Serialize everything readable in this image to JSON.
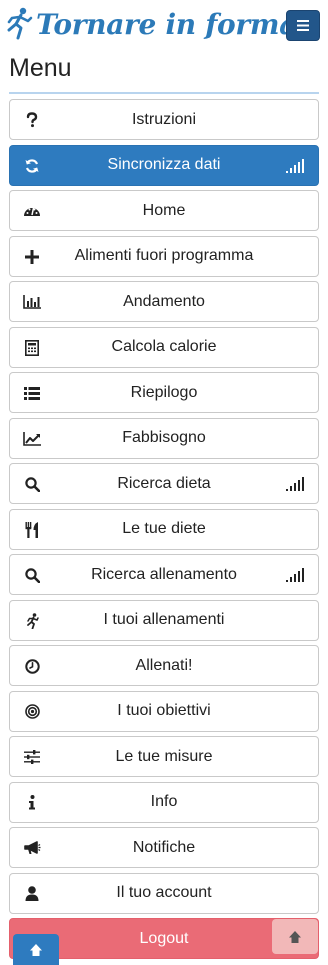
{
  "header": {
    "title": "Tornare in forma!"
  },
  "menu": {
    "title": "Menu",
    "items": [
      {
        "label": "Istruzioni",
        "icon": "question-icon",
        "signal": false
      },
      {
        "label": "Sincronizza dati",
        "icon": "sync-icon",
        "signal": true,
        "active": true
      },
      {
        "label": "Home",
        "icon": "dashboard-icon",
        "signal": false
      },
      {
        "label": "Alimenti fuori programma",
        "icon": "plus-icon",
        "signal": false
      },
      {
        "label": "Andamento",
        "icon": "bar-chart-icon",
        "signal": false
      },
      {
        "label": "Calcola calorie",
        "icon": "calculator-icon",
        "signal": false
      },
      {
        "label": "Riepilogo",
        "icon": "list-icon",
        "signal": false
      },
      {
        "label": "Fabbisogno",
        "icon": "line-chart-icon",
        "signal": false
      },
      {
        "label": "Ricerca dieta",
        "icon": "search-icon",
        "signal": true
      },
      {
        "label": "Le tue diete",
        "icon": "utensils-icon",
        "signal": false
      },
      {
        "label": "Ricerca allenamento",
        "icon": "search-icon",
        "signal": true
      },
      {
        "label": "I tuoi allenamenti",
        "icon": "running-icon",
        "signal": false
      },
      {
        "label": "Allenati!",
        "icon": "clock-icon",
        "signal": false
      },
      {
        "label": "I tuoi obiettivi",
        "icon": "target-icon",
        "signal": false
      },
      {
        "label": "Le tue misure",
        "icon": "sliders-icon",
        "signal": false
      },
      {
        "label": "Info",
        "icon": "info-icon",
        "signal": false
      },
      {
        "label": "Notifiche",
        "icon": "megaphone-icon",
        "signal": false
      },
      {
        "label": "Il tuo account",
        "icon": "user-icon",
        "signal": false
      },
      {
        "label": "Logout",
        "icon": "",
        "signal": false,
        "logout": true
      }
    ]
  },
  "colors": {
    "brand": "#2c7ab8",
    "active": "#2e7bbf",
    "hamburger": "#22568a",
    "logout": "#ea6b76",
    "scroll_top_right": "#f2b8b8"
  }
}
